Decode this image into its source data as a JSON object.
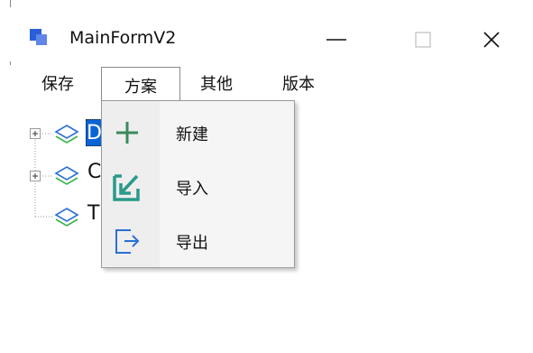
{
  "window": {
    "title": "MainFormV2"
  },
  "titlebar": {
    "minimize_glyph": "—",
    "maximize_glyph": "☐",
    "close_glyph": "✕"
  },
  "menu": [
    {
      "label": "保存"
    },
    {
      "label": "方案",
      "open": true
    },
    {
      "label": "其他"
    },
    {
      "label": "版本"
    }
  ],
  "dropdown": {
    "items": [
      {
        "label": "新建",
        "icon": "plus-icon"
      },
      {
        "label": "导入",
        "icon": "import-icon"
      },
      {
        "label": "导出",
        "icon": "export-icon"
      }
    ]
  },
  "tree": {
    "nodes": [
      {
        "label": "D",
        "expandable": true,
        "selected": true
      },
      {
        "label": "C",
        "expandable": true,
        "selected": false
      },
      {
        "label": "T",
        "expandable": false,
        "selected": false
      }
    ]
  },
  "colors": {
    "accent_green": "#3a8a5a",
    "import_teal": "#2a9a8a",
    "export_blue": "#2a6fd6",
    "app_icon_blue": "#2b5fd9"
  }
}
